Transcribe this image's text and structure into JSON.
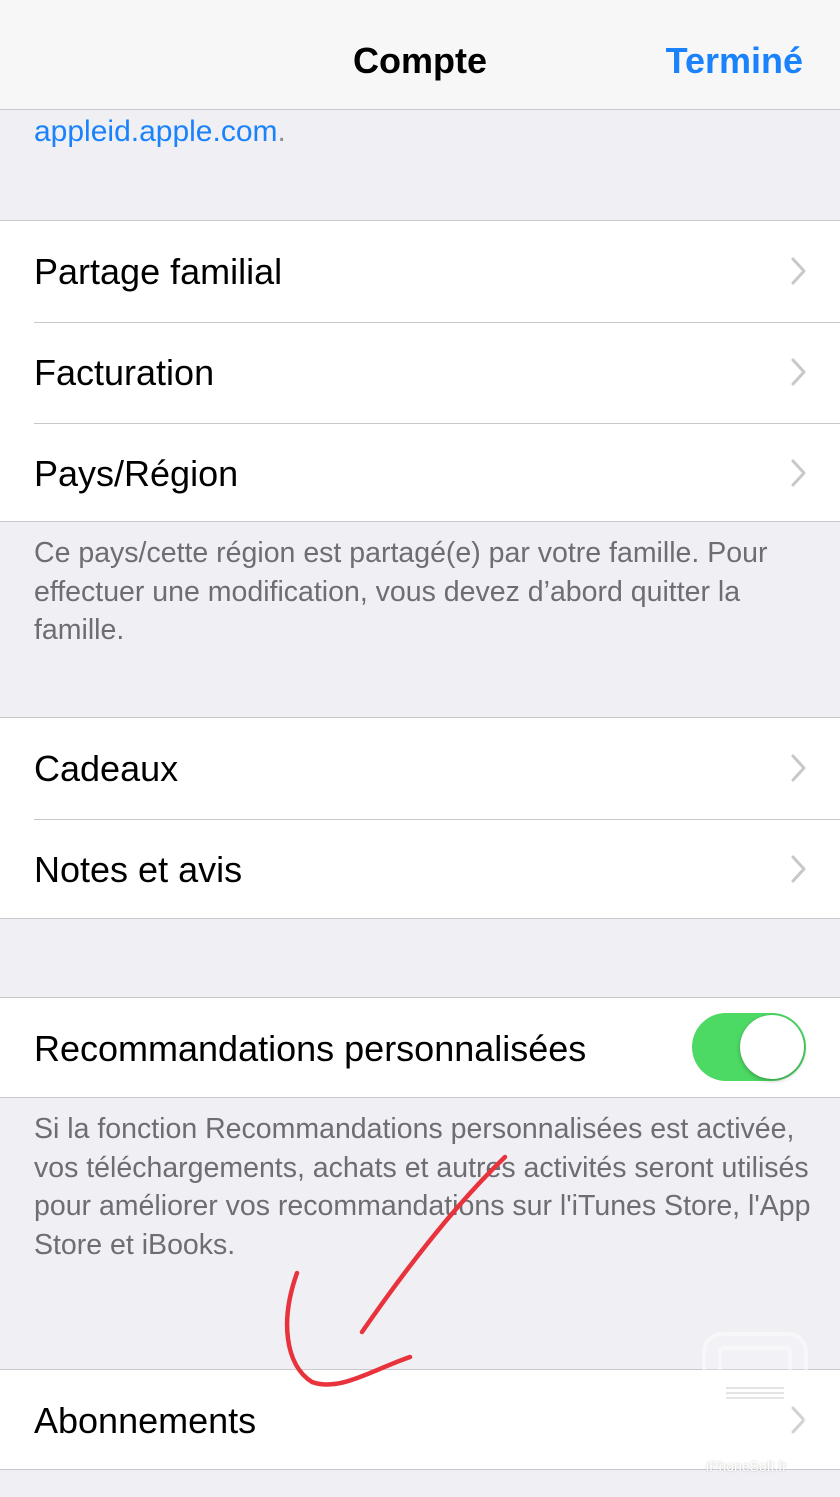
{
  "navbar": {
    "title": "Compte",
    "done_label": "Terminé"
  },
  "apple_link": {
    "link_text": "appleid.apple.com",
    "suffix": "."
  },
  "group1": {
    "items": [
      {
        "label": "Partage familial"
      },
      {
        "label": "Facturation"
      },
      {
        "label": "Pays/Région"
      }
    ],
    "footer": "Ce pays/cette région est partagé(e) par votre famille. Pour effectuer une modification, vous devez d’abord quitter la famille."
  },
  "group2": {
    "items": [
      {
        "label": "Cadeaux"
      },
      {
        "label": "Notes et avis"
      }
    ]
  },
  "group3": {
    "label": "Recommandations personnalisées",
    "toggle_on": true,
    "footer": "Si la fonction Recommandations personnalisées est activée, vos téléchargements, achats et autres activités seront utilisés pour améliorer vos recommandations sur l'iTunes Store, l'App Store et iBooks."
  },
  "group4": {
    "items": [
      {
        "label": "Abonnements"
      }
    ]
  },
  "watermark": {
    "text": "iPhoneSoft.fr"
  },
  "colors": {
    "accent": "#1a82fb",
    "toggle_on": "#4cd964",
    "background": "#efeff4",
    "annotation": "#e8323c"
  },
  "icons": [
    "chevron-right-icon",
    "hand-drawn-arrow",
    "iphonesoft-logo"
  ]
}
